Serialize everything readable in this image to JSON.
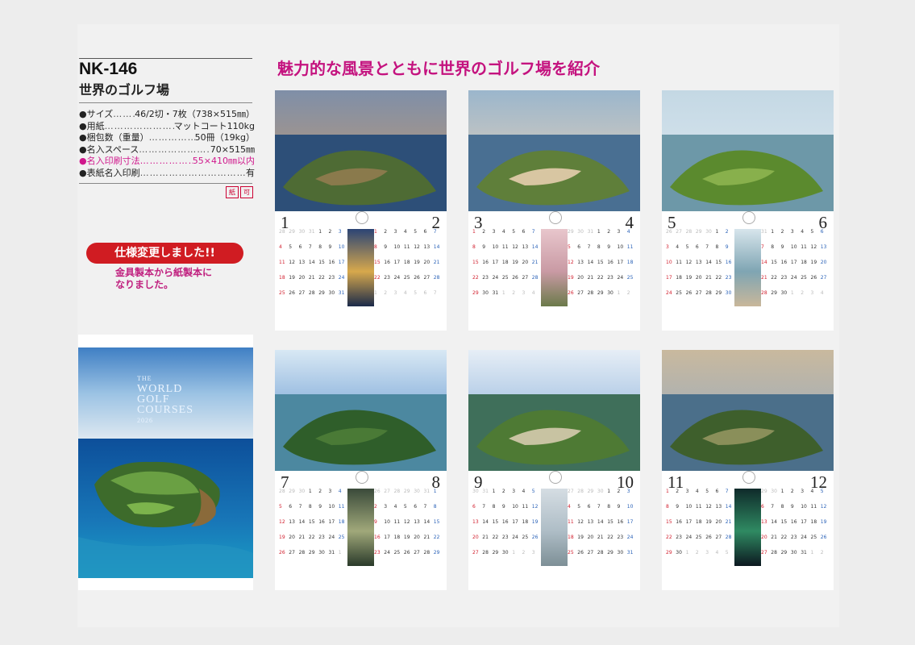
{
  "product": {
    "code": "NK-146",
    "name": "世界のゴルフ場"
  },
  "specs": [
    {
      "key": "●サイズ",
      "value": "46/2切・7枚（738×515㎜）",
      "highlight": false
    },
    {
      "key": "●用紙",
      "value": "マットコート110kg",
      "highlight": false
    },
    {
      "key": "●梱包数（重量）",
      "value": "50冊（19kg）",
      "highlight": false
    },
    {
      "key": "●名入スペース",
      "value": "70×515㎜",
      "highlight": false
    },
    {
      "key": "●名入印刷寸法",
      "value": "55×410㎜以内",
      "highlight": true
    },
    {
      "key": "●表紙名入印刷",
      "value": "有",
      "highlight": false
    }
  ],
  "badges": [
    "紙",
    "可"
  ],
  "notice": {
    "pill": "仕様変更しました!!",
    "text": "金具製本から紙製本に\nなりました。"
  },
  "headline": "魅力的な風景とともに世界のゴルフ場を紹介",
  "cover": {
    "title_small": "THE",
    "title_lines": [
      "WORLD",
      "GOLF",
      "COURSES"
    ],
    "year": "2026"
  },
  "colors": {
    "accent_magenta": "#c4137f",
    "notice_red": "#d01c22",
    "sunday_red": "#d2202f",
    "saturday_blue": "#2a62b8"
  },
  "months": [
    {
      "left": "1",
      "right": "2",
      "theme": "dusk",
      "left_rows": [
        [
          "28",
          "29",
          "30",
          "31",
          "1",
          "2",
          "3"
        ],
        [
          "4",
          "5",
          "6",
          "7",
          "8",
          "9",
          "10"
        ],
        [
          "11",
          "12",
          "13",
          "14",
          "15",
          "16",
          "17"
        ],
        [
          "18",
          "19",
          "20",
          "21",
          "22",
          "23",
          "24"
        ],
        [
          "25",
          "26",
          "27",
          "28",
          "29",
          "30",
          "31"
        ]
      ],
      "right_rows": [
        [
          "1",
          "2",
          "3",
          "4",
          "5",
          "6",
          "7"
        ],
        [
          "8",
          "9",
          "10",
          "11",
          "12",
          "13",
          "14"
        ],
        [
          "15",
          "16",
          "17",
          "18",
          "19",
          "20",
          "21"
        ],
        [
          "22",
          "23",
          "24",
          "25",
          "26",
          "27",
          "28"
        ],
        [
          "1",
          "2",
          "3",
          "4",
          "5",
          "6",
          "7"
        ]
      ]
    },
    {
      "left": "3",
      "right": "4",
      "theme": "blossom",
      "left_rows": [
        [
          "1",
          "2",
          "3",
          "4",
          "5",
          "6",
          "7"
        ],
        [
          "8",
          "9",
          "10",
          "11",
          "12",
          "13",
          "14"
        ],
        [
          "15",
          "16",
          "17",
          "18",
          "19",
          "20",
          "21"
        ],
        [
          "22",
          "23",
          "24",
          "25",
          "26",
          "27",
          "28"
        ],
        [
          "29",
          "30",
          "31",
          "1",
          "2",
          "3",
          "4"
        ]
      ],
      "right_rows": [
        [
          "29",
          "30",
          "31",
          "1",
          "2",
          "3",
          "4"
        ],
        [
          "5",
          "6",
          "7",
          "8",
          "9",
          "10",
          "11"
        ],
        [
          "12",
          "13",
          "14",
          "15",
          "16",
          "17",
          "18"
        ],
        [
          "19",
          "20",
          "21",
          "22",
          "23",
          "24",
          "25"
        ],
        [
          "26",
          "27",
          "28",
          "29",
          "30",
          "1",
          "2"
        ]
      ]
    },
    {
      "left": "5",
      "right": "6",
      "theme": "shore",
      "left_rows": [
        [
          "26",
          "27",
          "28",
          "29",
          "30",
          "1",
          "2"
        ],
        [
          "3",
          "4",
          "5",
          "6",
          "7",
          "8",
          "9"
        ],
        [
          "10",
          "11",
          "12",
          "13",
          "14",
          "15",
          "16"
        ],
        [
          "17",
          "18",
          "19",
          "20",
          "21",
          "22",
          "23"
        ],
        [
          "24",
          "25",
          "26",
          "27",
          "28",
          "29",
          "30"
        ]
      ],
      "right_rows": [
        [
          "31",
          "1",
          "2",
          "3",
          "4",
          "5",
          "6"
        ],
        [
          "7",
          "8",
          "9",
          "10",
          "11",
          "12",
          "13"
        ],
        [
          "14",
          "15",
          "16",
          "17",
          "18",
          "19",
          "20"
        ],
        [
          "21",
          "22",
          "23",
          "24",
          "25",
          "26",
          "27"
        ],
        [
          "28",
          "29",
          "30",
          "1",
          "2",
          "3",
          "4"
        ]
      ]
    },
    {
      "left": "7",
      "right": "8",
      "theme": "lake",
      "left_rows": [
        [
          "28",
          "29",
          "30",
          "1",
          "2",
          "3",
          "4"
        ],
        [
          "5",
          "6",
          "7",
          "8",
          "9",
          "10",
          "11"
        ],
        [
          "12",
          "13",
          "14",
          "15",
          "16",
          "17",
          "18"
        ],
        [
          "19",
          "20",
          "21",
          "22",
          "23",
          "24",
          "25"
        ],
        [
          "26",
          "27",
          "28",
          "29",
          "30",
          "31",
          "1"
        ]
      ],
      "right_rows": [
        [
          "26",
          "27",
          "28",
          "29",
          "30",
          "31",
          "1"
        ],
        [
          "2",
          "3",
          "4",
          "5",
          "6",
          "7",
          "8"
        ],
        [
          "9",
          "10",
          "11",
          "12",
          "13",
          "14",
          "15"
        ],
        [
          "16",
          "17",
          "18",
          "19",
          "20",
          "21",
          "22"
        ],
        [
          "23",
          "24",
          "25",
          "26",
          "27",
          "28",
          "29"
        ]
      ]
    },
    {
      "left": "9",
      "right": "10",
      "theme": "mist",
      "left_rows": [
        [
          "30",
          "31",
          "1",
          "2",
          "3",
          "4",
          "5"
        ],
        [
          "6",
          "7",
          "8",
          "9",
          "10",
          "11",
          "12"
        ],
        [
          "13",
          "14",
          "15",
          "16",
          "17",
          "18",
          "19"
        ],
        [
          "20",
          "21",
          "22",
          "23",
          "24",
          "25",
          "26"
        ],
        [
          "27",
          "28",
          "29",
          "30",
          "1",
          "2",
          "3"
        ]
      ],
      "right_rows": [
        [
          "27",
          "28",
          "29",
          "30",
          "1",
          "2",
          "3"
        ],
        [
          "4",
          "5",
          "6",
          "7",
          "8",
          "9",
          "10"
        ],
        [
          "11",
          "12",
          "13",
          "14",
          "15",
          "16",
          "17"
        ],
        [
          "18",
          "19",
          "20",
          "21",
          "22",
          "23",
          "24"
        ],
        [
          "25",
          "26",
          "27",
          "28",
          "29",
          "30",
          "31"
        ]
      ]
    },
    {
      "left": "11",
      "right": "12",
      "theme": "aurora",
      "left_rows": [
        [
          "1",
          "2",
          "3",
          "4",
          "5",
          "6",
          "7"
        ],
        [
          "8",
          "9",
          "10",
          "11",
          "12",
          "13",
          "14"
        ],
        [
          "15",
          "16",
          "17",
          "18",
          "19",
          "20",
          "21"
        ],
        [
          "22",
          "23",
          "24",
          "25",
          "26",
          "27",
          "28"
        ],
        [
          "29",
          "30",
          "1",
          "2",
          "3",
          "4",
          "5"
        ]
      ],
      "right_rows": [
        [
          "29",
          "30",
          "1",
          "2",
          "3",
          "4",
          "5"
        ],
        [
          "6",
          "7",
          "8",
          "9",
          "10",
          "11",
          "12"
        ],
        [
          "13",
          "14",
          "15",
          "16",
          "17",
          "18",
          "19"
        ],
        [
          "20",
          "21",
          "22",
          "23",
          "24",
          "25",
          "26"
        ],
        [
          "27",
          "28",
          "29",
          "30",
          "31",
          "1",
          "2"
        ]
      ]
    }
  ]
}
